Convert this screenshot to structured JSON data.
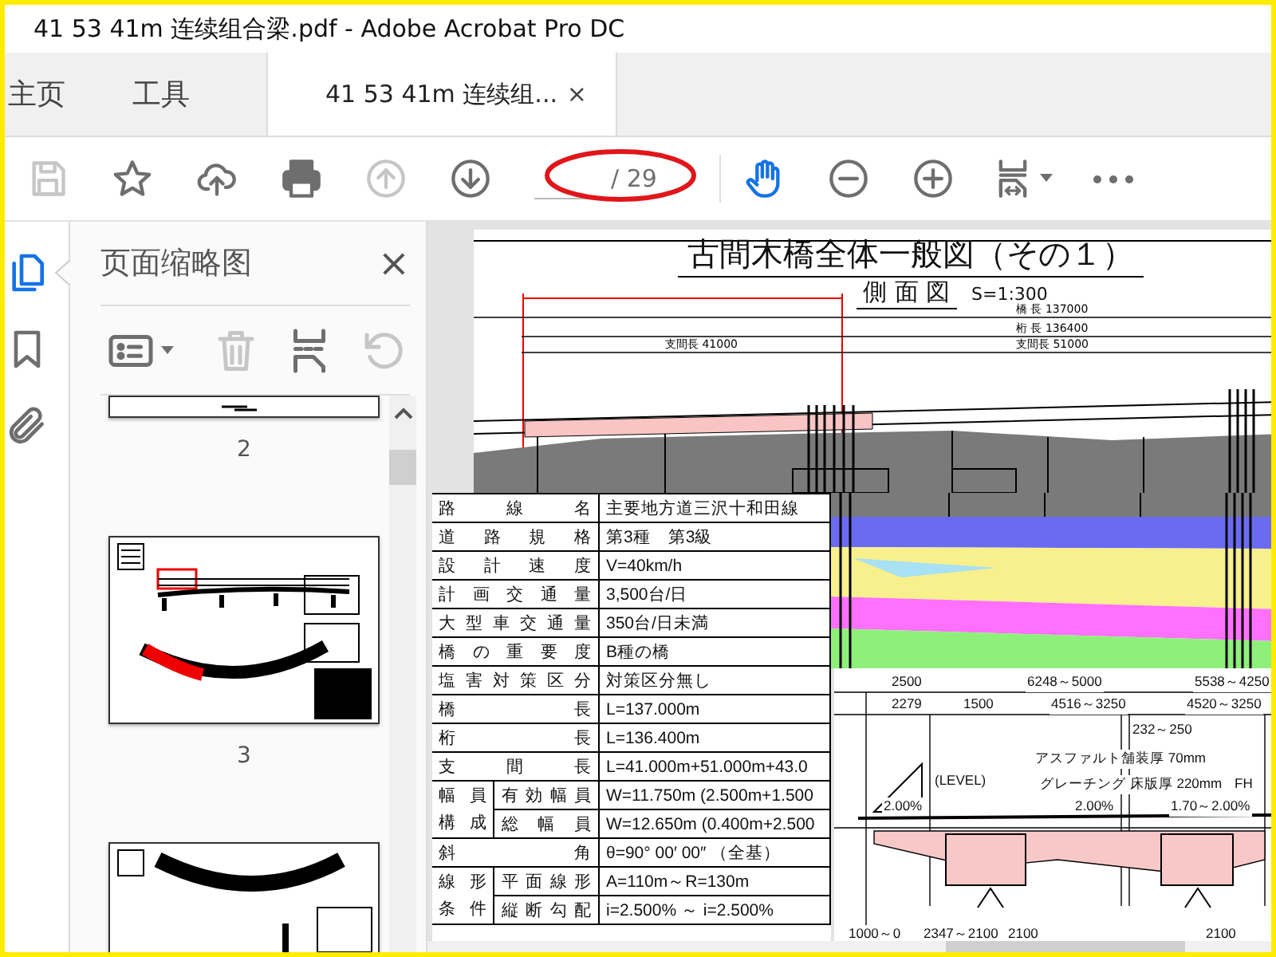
{
  "window": {
    "title": "41 53 41m 连续组合梁.pdf - Adobe Acrobat Pro DC"
  },
  "tabs": [
    {
      "label": "主页",
      "selected": false
    },
    {
      "label": "工具",
      "selected": false
    },
    {
      "label": "41 53 41m 连续组...",
      "selected": true,
      "close": "×"
    }
  ],
  "toolbar": [
    {
      "kind": "save",
      "disabled": true,
      "selected": false
    },
    {
      "kind": "star",
      "disabled": false,
      "selected": false
    },
    {
      "kind": "upload",
      "disabled": false,
      "selected": false
    },
    {
      "kind": "print",
      "disabled": false,
      "selected": false
    },
    {
      "kind": "prev",
      "disabled": true,
      "selected": false
    },
    {
      "kind": "next",
      "disabled": false,
      "selected": false
    },
    {
      "kind": "page",
      "disabled": false,
      "selected": false,
      "total": "/ 29"
    },
    {
      "kind": "hand",
      "disabled": false,
      "selected": true
    },
    {
      "kind": "zoom-out",
      "disabled": false,
      "selected": false
    },
    {
      "kind": "zoom-in",
      "disabled": false,
      "selected": false
    },
    {
      "kind": "fit",
      "disabled": false,
      "selected": false
    },
    {
      "kind": "more",
      "disabled": false,
      "selected": false
    }
  ],
  "rail": [
    {
      "kind": "pages",
      "selected": true
    },
    {
      "kind": "bookmarks",
      "selected": false
    },
    {
      "kind": "attachments",
      "selected": false
    }
  ],
  "panel": {
    "title": "页面缩略图",
    "close": "×",
    "tools": [
      {
        "kind": "options",
        "disabled": false
      },
      {
        "kind": "trash",
        "disabled": true
      },
      {
        "kind": "extract",
        "disabled": false
      },
      {
        "kind": "undo",
        "disabled": true
      }
    ],
    "thumbnails": [
      {
        "kind": "cut",
        "number": "2"
      },
      {
        "kind": "elevation",
        "number": "3"
      },
      {
        "kind": "plan"
      }
    ]
  },
  "drawing": {
    "title": "古間木橋全体一般図（その１）",
    "view": "側 面 図",
    "scale": "S=1:300",
    "dims": [
      "橋 長 137000",
      "桁 長 136400",
      "支間長 41000",
      "支間長 51000"
    ],
    "layers": [
      {
        "color": "#7a7a7a"
      },
      {
        "color": "#6b6bf2"
      },
      {
        "color": "#f7f08c"
      },
      {
        "color": "#a8e0f4"
      },
      {
        "color": "#ff70ff"
      },
      {
        "color": "#8ef07a"
      }
    ]
  },
  "conditions": {
    "rows": [
      {
        "label": "路線名",
        "value": "主要地方道三沢十和田線"
      },
      {
        "label": "道路規格",
        "value": "第3種　第3級"
      },
      {
        "label": "設計速度",
        "value": "V=40km/h"
      },
      {
        "label": "計画交通量",
        "value": "3,500台/日"
      },
      {
        "label": "大型車交通量",
        "value": "350台/日未満"
      },
      {
        "label": "橋の重要度",
        "value": "B種の橋"
      },
      {
        "label": "塩害対策区分",
        "value": "対策区分無し"
      },
      {
        "label": "橋長",
        "value": "L=137.000m"
      },
      {
        "label": "桁長",
        "value": "L=136.400m"
      },
      {
        "label": "支間長",
        "value": "L=41.000m+51.000m+43.0"
      },
      {
        "label": "幅員構成",
        "items": [
          {
            "label": "有効幅員",
            "value": "W=11.750m (2.500m+1.500"
          },
          {
            "label": "総幅員",
            "value": "W=12.650m (0.400m+2.500"
          }
        ]
      },
      {
        "label": "斜角",
        "value": "θ=90° 00′ 00″ （全基）"
      },
      {
        "label": "線形条件",
        "items": [
          {
            "label": "平面線形",
            "value": "A=110m～R=130m"
          },
          {
            "label": "縦断勾配",
            "value": "i=2.500% ～ i=2.500%"
          }
        ]
      }
    ]
  },
  "section": {
    "labels": [
      "2500",
      "6248～5000",
      "5538～4250",
      "2279",
      "1500",
      "4516～3250",
      "4520～3250",
      "232～250",
      "アスファルト舗装厚 70mm",
      "(LEVEL)",
      "グレーチング 床版厚 220mm",
      "FH",
      "2.00%",
      "2.00%",
      "1.70～2.00%",
      "1000～0",
      "2347～2100",
      "2100",
      "2100"
    ]
  }
}
